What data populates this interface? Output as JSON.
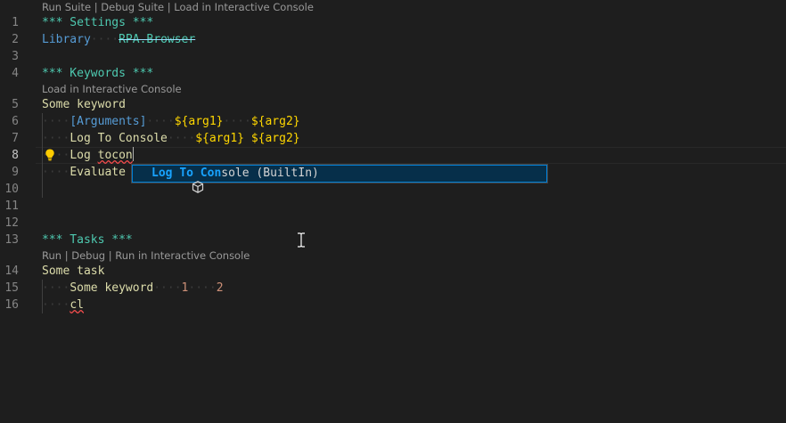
{
  "editor": {
    "line_numbers": [
      "1",
      "2",
      "3",
      "4",
      "5",
      "6",
      "7",
      "8",
      "9",
      "10",
      "11",
      "12",
      "13",
      "14",
      "15",
      "16"
    ],
    "codelens": {
      "suite": {
        "run": "Run Suite",
        "debug": "Debug Suite",
        "interactive": "Load in Interactive Console",
        "sep": " | "
      },
      "keywords": {
        "interactive": "Load in Interactive Console"
      },
      "tasks": {
        "run": "Run",
        "debug": "Debug",
        "interactive": "Run in Interactive Console",
        "sep": " | "
      }
    },
    "lines": {
      "l1": {
        "text": "*** Settings ***"
      },
      "l2": {
        "setting": "Library",
        "ws": "····",
        "library": "RPA.Browser"
      },
      "l4": {
        "text": "*** Keywords ***"
      },
      "l5": {
        "text": "Some keyword"
      },
      "l6": {
        "indent": "····",
        "arg_kw": "[Arguments]",
        "ws1": "····",
        "var1": "${arg1}",
        "ws2": "····",
        "var2": "${arg2}"
      },
      "l7": {
        "indent": "····",
        "name": "Log To Console",
        "ws1": "····",
        "var1": "${arg1}",
        "ws2": " ",
        "var2": "${arg2}"
      },
      "l8": {
        "indent": "····",
        "typed_prefix": "Log ",
        "typed_error": "tocon"
      },
      "l9": {
        "indent": "····",
        "text": "Evaluate"
      },
      "l13": {
        "text": "*** Tasks ***"
      },
      "l14": {
        "text": "Some task"
      },
      "l15": {
        "indent": "····",
        "name": "Some keyword",
        "ws1": "····",
        "num1": "1",
        "ws2": "····",
        "num2": "2"
      },
      "l16": {
        "indent": "····",
        "typed": "cl"
      }
    },
    "suggest": {
      "icon": "keyword-box-icon",
      "match1": "Log",
      "plain1": " ",
      "match2": "To",
      "plain2": " ",
      "match3": "Con",
      "rest": "sole (BuiltIn)"
    },
    "colors": {
      "background": "#1e1e1e",
      "section": "#4ec9b0",
      "setting": "#569cd6",
      "keyword_name": "#dcdcaa",
      "variable": "#ffd700",
      "number": "#ce9178",
      "error": "#f14c4c",
      "suggest_highlight": "#18a3ff",
      "suggest_selected_bg": "#062f4a",
      "lightbulb": "#ffcc00"
    }
  }
}
